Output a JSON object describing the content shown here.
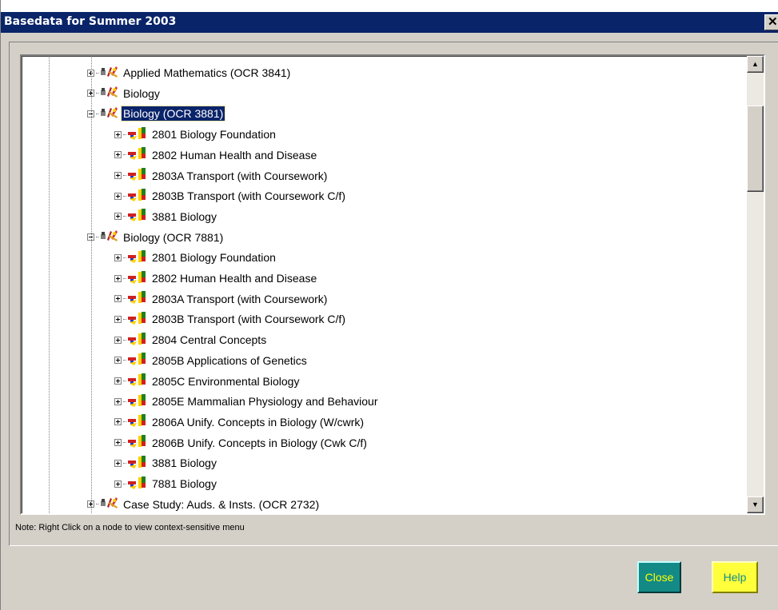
{
  "window": {
    "title": "Basedata for Summer 2003",
    "close_glyph": "✕"
  },
  "tree": {
    "nodes": [
      {
        "label": "Applied Mathematics (OCR 3841)",
        "level": 1,
        "state": "collapsed",
        "icon": "qualification-icon"
      },
      {
        "label": "Biology",
        "level": 1,
        "state": "collapsed",
        "icon": "qualification-icon"
      },
      {
        "label": "Biology (OCR 3881)",
        "level": 1,
        "state": "expanded",
        "icon": "qualification-icon",
        "selected": true
      },
      {
        "label": "2801 Biology Foundation",
        "level": 2,
        "state": "collapsed",
        "icon": "unit-icon"
      },
      {
        "label": "2802 Human Health and Disease",
        "level": 2,
        "state": "collapsed",
        "icon": "unit-icon"
      },
      {
        "label": "2803A Transport  (with Coursework)",
        "level": 2,
        "state": "collapsed",
        "icon": "unit-icon"
      },
      {
        "label": "2803B Transport  (with Coursework C/f)",
        "level": 2,
        "state": "collapsed",
        "icon": "unit-icon"
      },
      {
        "label": "3881 Biology",
        "level": 2,
        "state": "collapsed",
        "icon": "unit-icon"
      },
      {
        "label": "Biology (OCR 7881)",
        "level": 1,
        "state": "expanded",
        "icon": "qualification-icon"
      },
      {
        "label": "2801 Biology Foundation",
        "level": 2,
        "state": "collapsed",
        "icon": "unit-icon"
      },
      {
        "label": "2802 Human Health and Disease",
        "level": 2,
        "state": "collapsed",
        "icon": "unit-icon"
      },
      {
        "label": "2803A Transport  (with Coursework)",
        "level": 2,
        "state": "collapsed",
        "icon": "unit-icon"
      },
      {
        "label": "2803B Transport  (with Coursework C/f)",
        "level": 2,
        "state": "collapsed",
        "icon": "unit-icon"
      },
      {
        "label": "2804 Central Concepts",
        "level": 2,
        "state": "collapsed",
        "icon": "unit-icon"
      },
      {
        "label": "2805B Applications of Genetics",
        "level": 2,
        "state": "collapsed",
        "icon": "unit-icon"
      },
      {
        "label": "2805C Environmental Biology",
        "level": 2,
        "state": "collapsed",
        "icon": "unit-icon"
      },
      {
        "label": "2805E Mammalian Physiology and Behaviour",
        "level": 2,
        "state": "collapsed",
        "icon": "unit-icon"
      },
      {
        "label": "2806A Unify.  Concepts in Biology  (W/cwrk)",
        "level": 2,
        "state": "collapsed",
        "icon": "unit-icon"
      },
      {
        "label": "2806B Unify.  Concepts in Biology  (Cwk C/f)",
        "level": 2,
        "state": "collapsed",
        "icon": "unit-icon"
      },
      {
        "label": "3881 Biology",
        "level": 2,
        "state": "collapsed",
        "icon": "unit-icon"
      },
      {
        "label": "7881 Biology",
        "level": 2,
        "state": "collapsed",
        "icon": "unit-icon"
      },
      {
        "label": "Case Study:  Auds. & Insts.  (OCR 2732)",
        "level": 1,
        "state": "collapsed",
        "icon": "qualification-icon"
      }
    ],
    "scroll_position": 0.12
  },
  "note": "Note: Right Click on a node to view context-sensitive menu",
  "buttons": {
    "close_label": "Close",
    "help_label": "Help"
  },
  "colors": {
    "title_bar": "#0a246a",
    "dialog_bg": "#d4d0c8",
    "close_button": "#138a86",
    "help_button": "#ffff3b"
  }
}
